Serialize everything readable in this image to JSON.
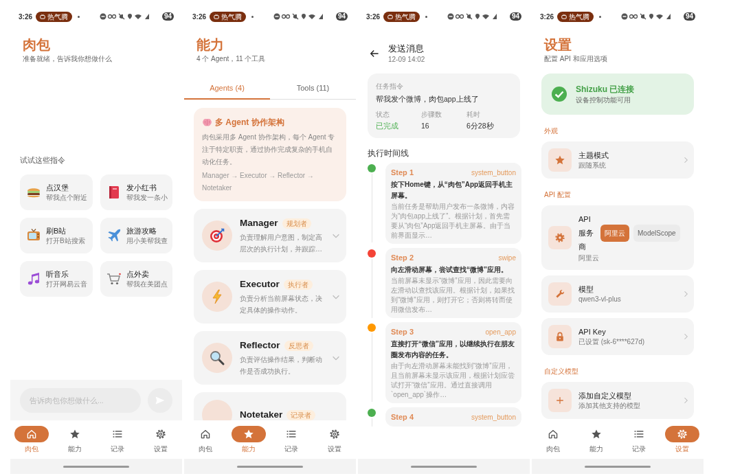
{
  "screens": [
    {
      "kind": "home",
      "status_bar": {
        "time": "3:26",
        "notification": "热气腾",
        "battery": "94"
      },
      "title": "肉包",
      "subtitle": "准备就绪，告诉我你想做什么",
      "suggestions_title": "试试这些指令",
      "suggestions": [
        {
          "title": "点汉堡",
          "subtitle": "帮我点个附近"
        },
        {
          "title": "发小红书",
          "subtitle": "帮我发一条小"
        },
        {
          "title": "刷B站",
          "subtitle": "打开B站搜索"
        },
        {
          "title": "旅游攻略",
          "subtitle": "用小美帮我查"
        },
        {
          "title": "听音乐",
          "subtitle": "打开网易云音"
        },
        {
          "title": "点外卖",
          "subtitle": "帮我在美团点"
        }
      ],
      "input": {
        "placeholder": "告诉肉包你想做什么..."
      },
      "nav": [
        {
          "label": "肉包",
          "selected": true
        },
        {
          "label": "能力",
          "selected": false
        },
        {
          "label": "记录",
          "selected": false
        },
        {
          "label": "设置",
          "selected": false
        }
      ]
    },
    {
      "kind": "capabilities",
      "status_bar": {
        "time": "3:26",
        "notification": "热气腾",
        "battery": "94"
      },
      "title": "能力",
      "subtitle": "4 个 Agent，11 个工具",
      "tabs": [
        {
          "label": "Agents (4)",
          "selected": true
        },
        {
          "label": "Tools (11)",
          "selected": false
        }
      ],
      "intro": {
        "title": "多 Agent 协作架构",
        "text": "肉包采用多 Agent 协作架构，每个 Agent 专注于特定职责，通过协作完成复杂的手机自动化任务。",
        "flow": "Manager → Executor → Reflector → Notetaker"
      },
      "agents": [
        {
          "name": "Manager",
          "role": "规划者",
          "description": "负责理解用户意图，制定高层次的执行计划，并跟踪…"
        },
        {
          "name": "Executor",
          "role": "执行者",
          "description": "负责分析当前屏幕状态，决定具体的操作动作。"
        },
        {
          "name": "Reflector",
          "role": "反思者",
          "description": "负责评估操作结果，判断动作是否成功执行。"
        },
        {
          "name": "Notetaker",
          "role": "记录者"
        }
      ],
      "nav": [
        {
          "label": "肉包",
          "selected": false
        },
        {
          "label": "能力",
          "selected": true
        },
        {
          "label": "记录",
          "selected": false
        },
        {
          "label": "设置",
          "selected": false
        }
      ]
    },
    {
      "kind": "task_detail",
      "status_bar": {
        "time": "3:26",
        "notification": "热气腾",
        "battery": "94"
      },
      "title": "发送消息",
      "date": "12-09 14:02",
      "task": {
        "label": "任务指令",
        "text": "帮我发个微博，肉包app上线了",
        "stats": [
          {
            "label": "状态",
            "value": "已完成",
            "kind": "status"
          },
          {
            "label": "步骤数",
            "value": "16",
            "kind": "count"
          },
          {
            "label": "耗时",
            "value": "6分28秒",
            "kind": "count"
          }
        ]
      },
      "timeline_title": "执行时间线",
      "steps": [
        {
          "title": "Step 1",
          "action": "system_button",
          "color": "#4caf50",
          "summary": "按下Home键，从“肉包”App返回手机主屏幕。",
          "reason": "当前任务是帮助用户发布一条微博，内容为“肉包app上线了”。根据计划，首先需要从“肉包”App返回手机主屏幕。由于当前界面显示…"
        },
        {
          "title": "Step 2",
          "action": "swipe",
          "color": "#f44336",
          "summary": "向左滑动屏幕，尝试查找“微博”应用。",
          "reason": "当前屏幕未显示“微博”应用，因此需要向左滑动以查找该应用。根据计划，如果找到“微博”应用，则打开它；否则将转而使用微信发布…"
        },
        {
          "title": "Step 3",
          "action": "open_app",
          "color": "#ff9800",
          "summary": "直接打开“微信”应用，以继续执行在朋友圈发布内容的任务。",
          "reason": "由于向左滑动屏幕未能找到“微博”应用，且当前屏幕未显示该应用，根据计划应尝试打开“微信”应用。通过直接调用`open_app`操作…"
        },
        {
          "title": "Step 4",
          "action": "system_button",
          "color": "#4caf50"
        }
      ]
    },
    {
      "kind": "settings",
      "status_bar": {
        "time": "3:26",
        "notification": "热气腾",
        "battery": "94"
      },
      "title": "设置",
      "subtitle": "配置 API 和应用选项",
      "connection": {
        "title": "Shizuku 已连接",
        "subtitle": "设备控制功能可用"
      },
      "sections": [
        {
          "title": "外观",
          "items": [
            {
              "kind": "link",
              "title": "主题模式",
              "subtitle": "跟随系统"
            }
          ]
        },
        {
          "title": "API 配置",
          "items": [
            {
              "kind": "choice",
              "title": "API 服务商",
              "subtitle": "阿里云",
              "options": [
                {
                  "label": "阿里云",
                  "selected": true
                },
                {
                  "label": "ModelScope",
                  "selected": false
                }
              ]
            },
            {
              "kind": "link",
              "title": "模型",
              "subtitle": "qwen3-vl-plus"
            },
            {
              "kind": "link",
              "title": "API Key",
              "subtitle": "已设置 (sk-6****627d)"
            }
          ]
        },
        {
          "title": "自定义模型",
          "items": [
            {
              "kind": "link",
              "title": "添加自定义模型",
              "subtitle": "添加其他支持的模型"
            }
          ]
        }
      ],
      "nav": [
        {
          "label": "肉包",
          "selected": false
        },
        {
          "label": "能力",
          "selected": false
        },
        {
          "label": "记录",
          "selected": false
        },
        {
          "label": "设置",
          "selected": true
        }
      ]
    }
  ]
}
